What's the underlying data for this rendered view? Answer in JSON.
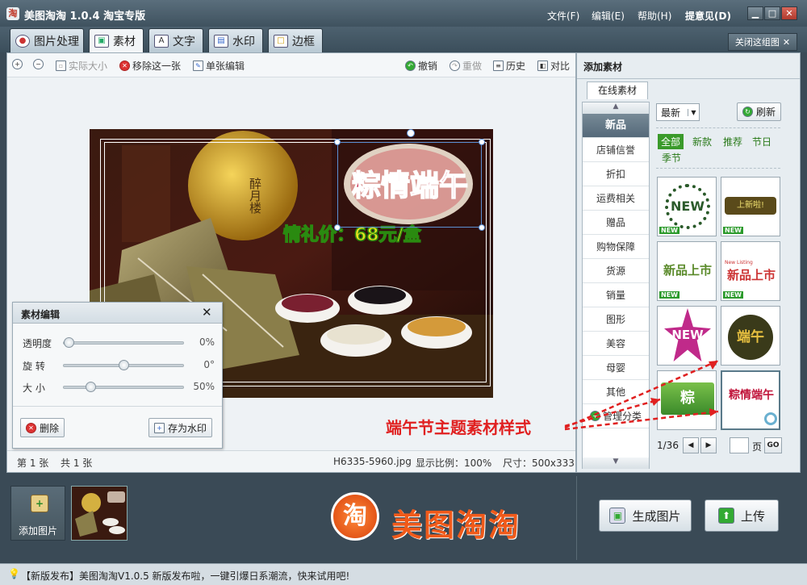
{
  "app": {
    "icon_char": "淘",
    "title": "美图淘淘 1.0.4 淘宝专版"
  },
  "menu": {
    "file": "文件(F)",
    "edit": "编辑(E)",
    "help": "帮助(H)",
    "feedback": "提意见(D)"
  },
  "window_controls": {
    "minimize": "▁",
    "maximize": "□",
    "close": "✕"
  },
  "tabs": [
    "图片处理",
    "素材",
    "文字",
    "水印",
    "边框"
  ],
  "close_image": "关闭这组图",
  "toolbar": {
    "actual_size": "实际大小",
    "remove_one": "移除这一张",
    "single_edit": "单张编辑",
    "undo": "撤销",
    "redo": "重做",
    "history": "历史",
    "compare": "对比"
  },
  "canvas": {
    "sticker_text": "粽情端午",
    "caption": "情礼价：68元/盒",
    "lantern_text": "醉月楼"
  },
  "panel": {
    "title": "素材编辑",
    "opacity_label": "透明度",
    "opacity_value": "0%",
    "rotate_label": "旋 转",
    "rotate_value": "0°",
    "size_label": "大 小",
    "size_value": "50%",
    "delete_label": "删除",
    "save_watermark_label": "存为水印",
    "opacity_level": 0,
    "rotate_level": 0.5,
    "size_level": 0.2
  },
  "status": {
    "page": "第 1 张",
    "total": "共 1 张",
    "filename": "H6335-5960.jpg",
    "ratio": "显示比例：100%",
    "size": "尺寸：500x333"
  },
  "right": {
    "title": "添加素材",
    "online_tab": "在线素材",
    "categories": [
      "新品",
      "店铺信誉",
      "折扣",
      "运费相关",
      "赠品",
      "购物保障",
      "货源",
      "销量",
      "图形",
      "美容",
      "母婴",
      "其他",
      "管理分类"
    ],
    "sort": "最新",
    "refresh": "刷新",
    "filters": [
      "全部",
      "新款",
      "推荐",
      "节日",
      "季节"
    ],
    "page": "1/36",
    "page_unit": "页",
    "go": "GO",
    "page_input": ""
  },
  "thumbs": {
    "t1": "NEW",
    "t2": "上新啦!",
    "t3": "新品上市",
    "t4": "新品上市",
    "t4_small": "New Listing",
    "t5": "NEW",
    "t6": "端午",
    "t7": "粽",
    "t8": "粽情端午",
    "new_tag": "NEW"
  },
  "annotation": "端午节主题素材样式",
  "bottom": {
    "add_image": "添加图片",
    "brand": "美图淘淘",
    "brand_icon": "淘",
    "generate": "生成图片",
    "upload": "上传"
  },
  "statusline": "【新版发布】美图淘淘V1.0.5 新版发布啦，一键引爆日系潮流，快来试用吧!",
  "colors": {
    "accent_red": "#e02020",
    "accent_green": "#2b9a2b",
    "brand_orange": "#f05a1a"
  }
}
